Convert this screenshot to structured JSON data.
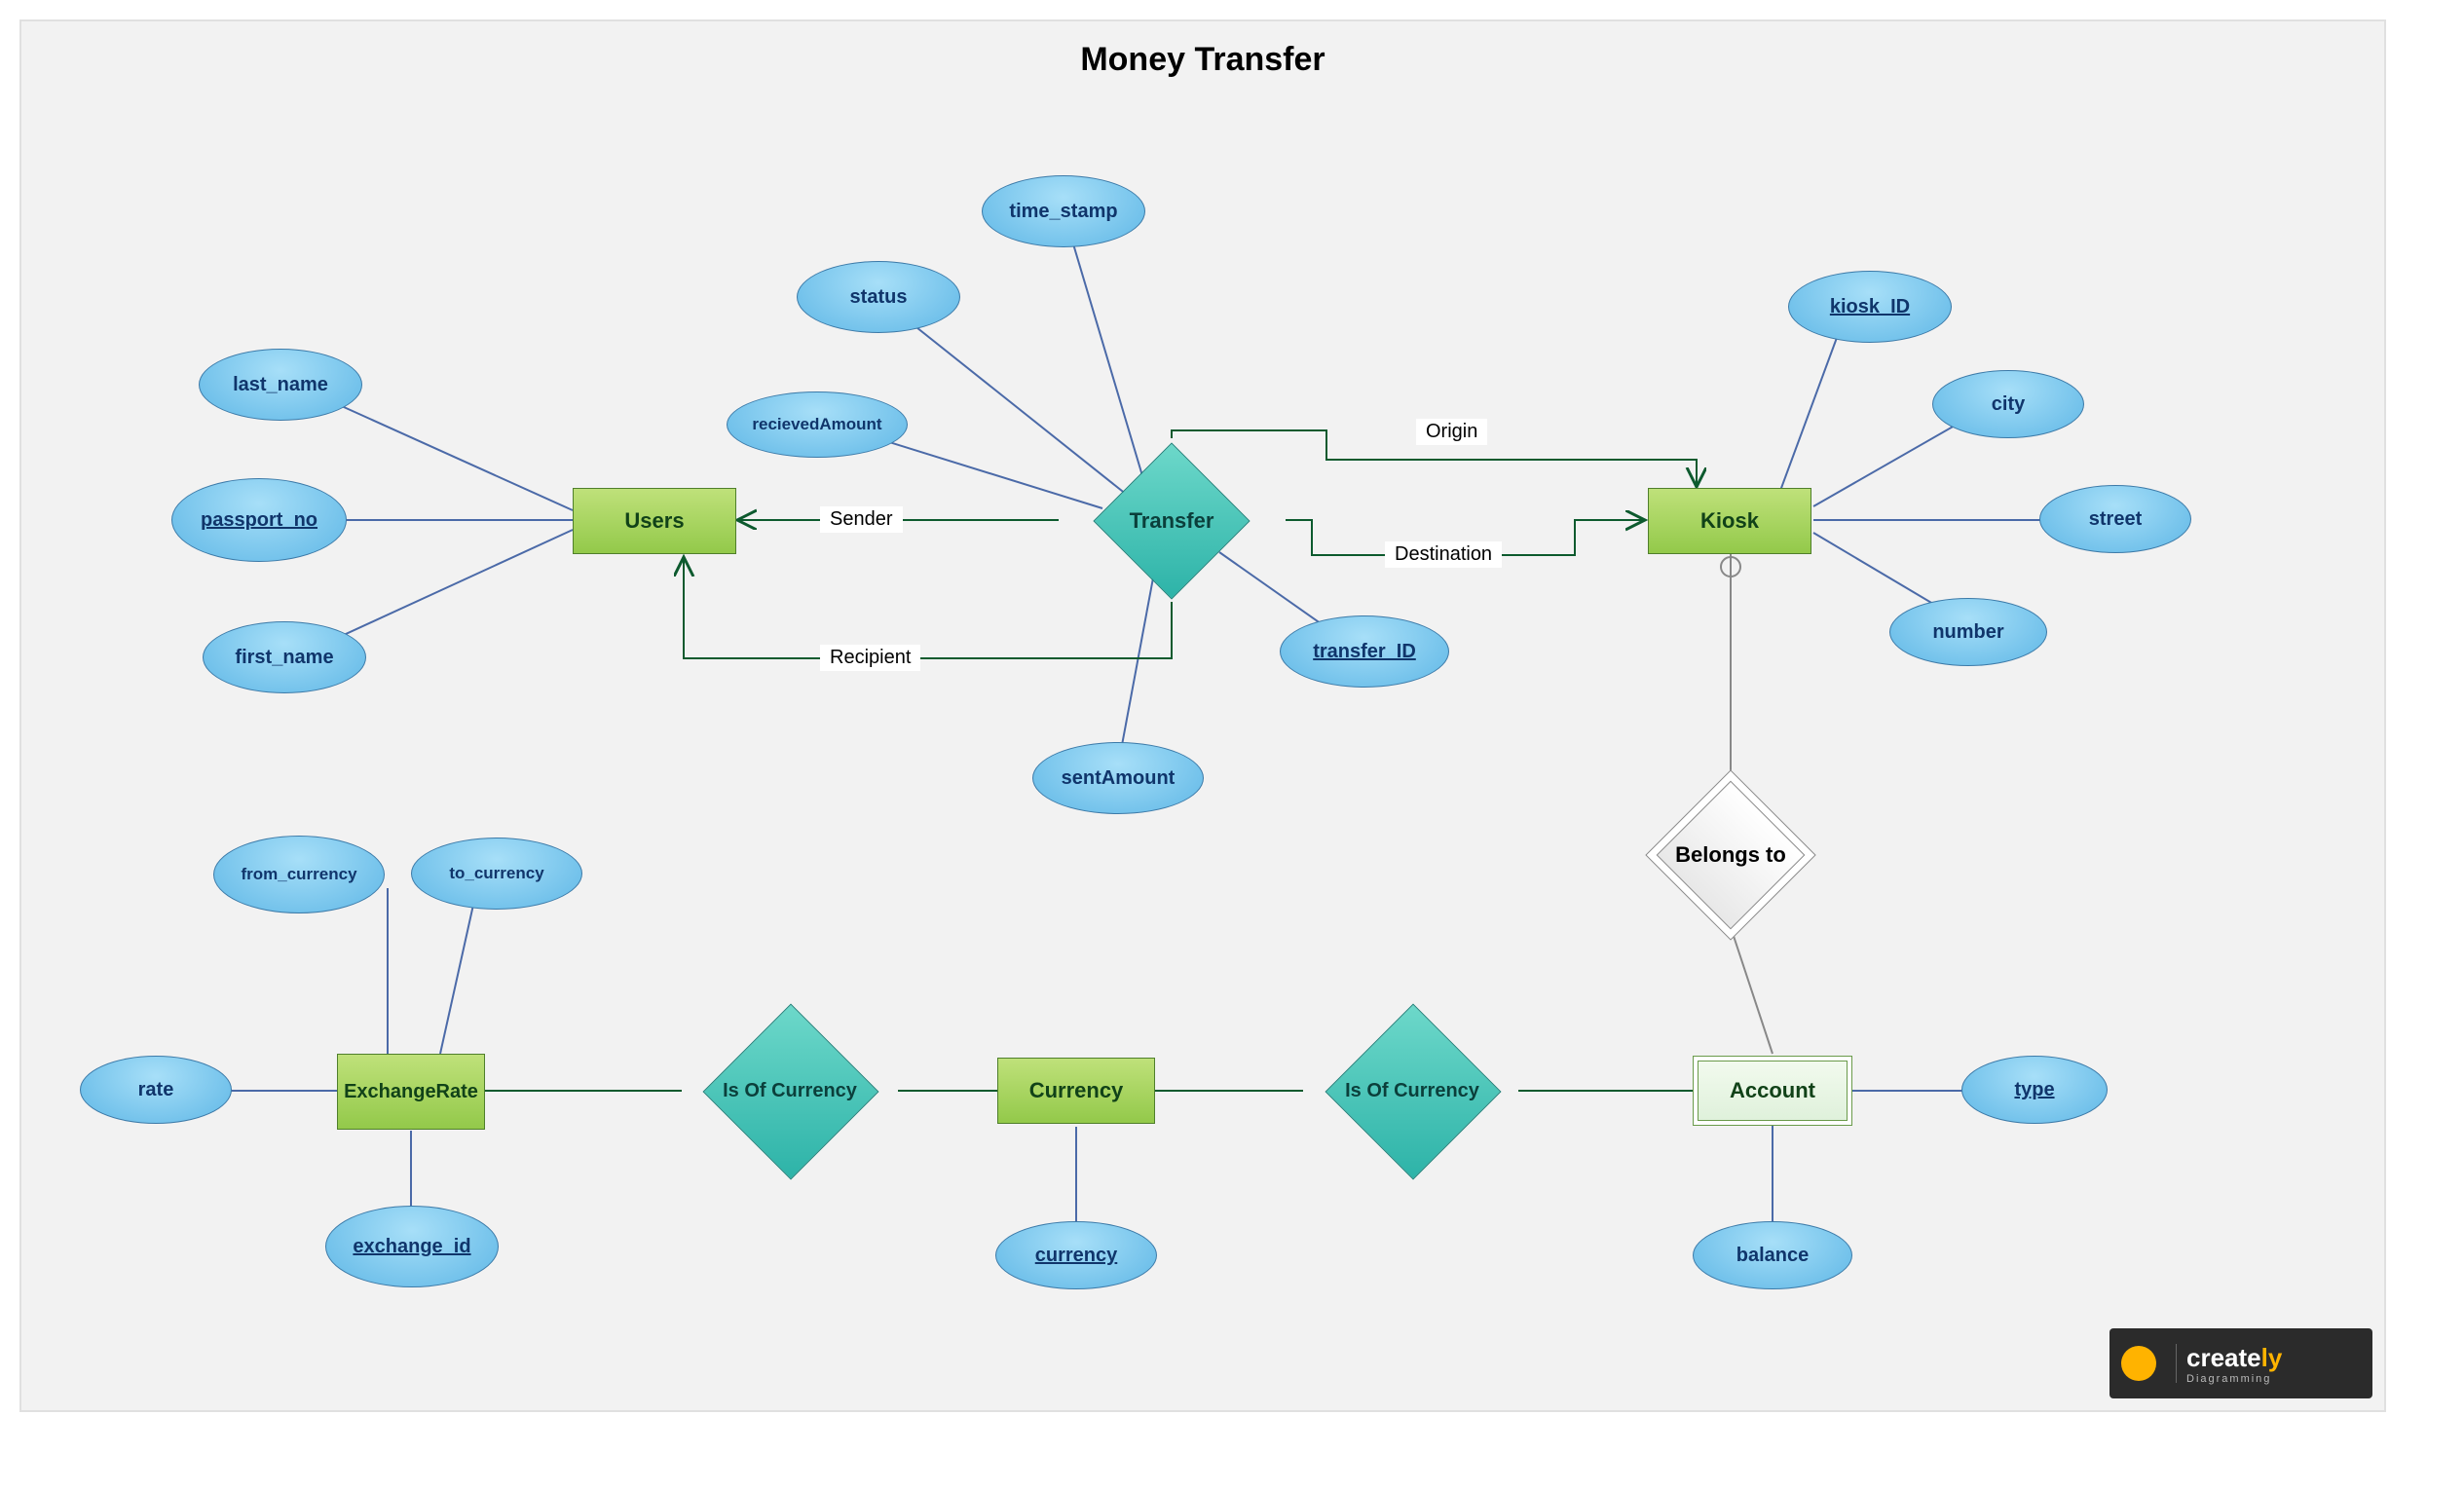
{
  "title": "Money Transfer",
  "entities": {
    "users": "Users",
    "kiosk": "Kiosk",
    "exchangeRate": "ExchangeRate",
    "currency": "Currency",
    "account": "Account"
  },
  "relationships": {
    "transfer": "Transfer",
    "isOfCurrency1": "Is Of Currency",
    "isOfCurrency2": "Is Of Currency",
    "belongsTo": "Belongs to"
  },
  "attributes": {
    "last_name": "last_name",
    "passport_no": "passport_no",
    "first_name": "first_name",
    "status": "status",
    "time_stamp": "time_stamp",
    "recievedAmount": "recievedAmount",
    "sentAmount": "sentAmount",
    "transfer_ID": "transfer_ID",
    "kiosk_ID": "kiosk_ID",
    "city": "city",
    "street": "street",
    "number": "number",
    "from_currency": "from_currency",
    "to_currency": "to_currency",
    "rate": "rate",
    "exchange_id": "exchange_id",
    "currency_attr": "currency",
    "balance": "balance",
    "type": "type"
  },
  "edge_labels": {
    "sender": "Sender",
    "recipient": "Recipient",
    "origin": "Origin",
    "destination": "Destination"
  },
  "watermark": {
    "brand_part1": "create",
    "brand_part2": "ly",
    "tagline": "Diagramming"
  }
}
